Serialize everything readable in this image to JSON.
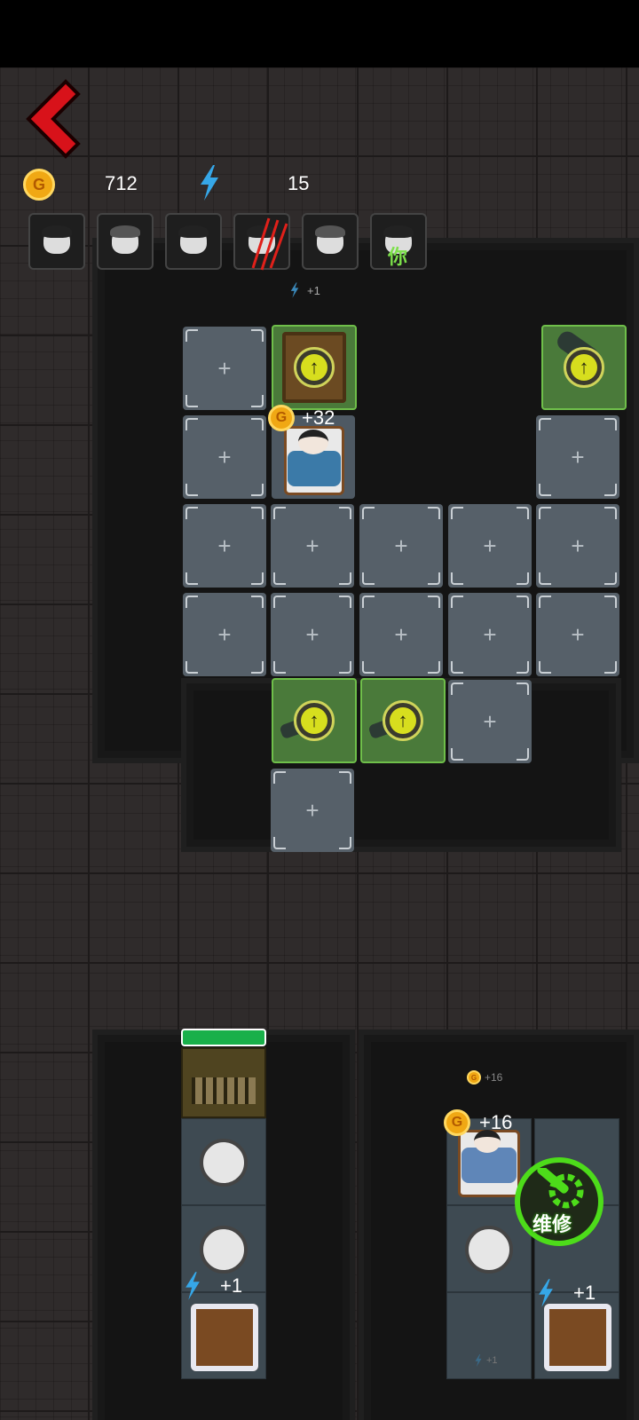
{
  "hud": {
    "coins": "712",
    "energy": "15"
  },
  "icons": {
    "back": "back-arrow-icon",
    "coin": "gold-coin-icon",
    "energy": "lightning-icon"
  },
  "coin_letter": "G",
  "plus_symbol": "+",
  "floating": {
    "energy_top": "+1",
    "coin_bed_top": "+32",
    "coin_small": "+16",
    "coin_bed_bottom": "+16",
    "energy_left": "+1",
    "energy_right": "+1",
    "energy_small": "+1"
  },
  "avatars": [
    {
      "name": "survivor-boy",
      "label": ""
    },
    {
      "name": "survivor-girl-bun",
      "label": ""
    },
    {
      "name": "survivor-girl-pigtails",
      "label": ""
    },
    {
      "name": "survivor-attacked",
      "label": ""
    },
    {
      "name": "survivor-girl-2",
      "label": ""
    },
    {
      "name": "survivor-you",
      "label": "你"
    }
  ],
  "repair_button": {
    "label": "维修"
  },
  "colors": {
    "accent_green": "#6fbf4a",
    "repair_green": "#4ddc1a",
    "back_red": "#d8121a",
    "coin_gold": "#f0a814",
    "energy_blue": "#36a7e8",
    "hp_bar": "#19b04a"
  }
}
